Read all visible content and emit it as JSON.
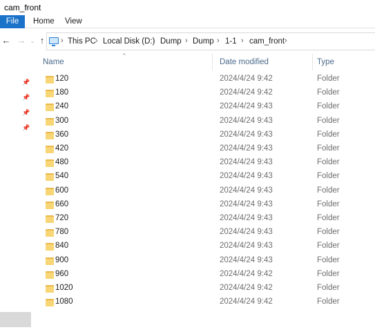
{
  "window": {
    "title": "cam_front"
  },
  "ribbon": {
    "tabs": [
      {
        "label": "File"
      },
      {
        "label": "Home"
      },
      {
        "label": "View"
      }
    ]
  },
  "nav": {
    "back_icon": "←",
    "forward_icon": "→",
    "recent_icon": "⌄",
    "up_icon": "↑",
    "breadcrumb": [
      "This PC",
      "Local Disk (D:)",
      "Dump",
      "Dump",
      "1-1",
      "cam_front"
    ],
    "separator": "›"
  },
  "columns": {
    "name": "Name",
    "date": "Date modified",
    "type": "Type",
    "sort_indicator": "^"
  },
  "files": [
    {
      "name": "120",
      "date": "2024/4/24 9:42",
      "type": "Folder"
    },
    {
      "name": "180",
      "date": "2024/4/24 9:42",
      "type": "Folder"
    },
    {
      "name": "240",
      "date": "2024/4/24 9:43",
      "type": "Folder"
    },
    {
      "name": "300",
      "date": "2024/4/24 9:43",
      "type": "Folder"
    },
    {
      "name": "360",
      "date": "2024/4/24 9:43",
      "type": "Folder"
    },
    {
      "name": "420",
      "date": "2024/4/24 9:43",
      "type": "Folder"
    },
    {
      "name": "480",
      "date": "2024/4/24 9:43",
      "type": "Folder"
    },
    {
      "name": "540",
      "date": "2024/4/24 9:43",
      "type": "Folder"
    },
    {
      "name": "600",
      "date": "2024/4/24 9:43",
      "type": "Folder"
    },
    {
      "name": "660",
      "date": "2024/4/24 9:43",
      "type": "Folder"
    },
    {
      "name": "720",
      "date": "2024/4/24 9:43",
      "type": "Folder"
    },
    {
      "name": "780",
      "date": "2024/4/24 9:43",
      "type": "Folder"
    },
    {
      "name": "840",
      "date": "2024/4/24 9:43",
      "type": "Folder"
    },
    {
      "name": "900",
      "date": "2024/4/24 9:43",
      "type": "Folder"
    },
    {
      "name": "960",
      "date": "2024/4/24 9:42",
      "type": "Folder"
    },
    {
      "name": "1020",
      "date": "2024/4/24 9:42",
      "type": "Folder"
    },
    {
      "name": "1080",
      "date": "2024/4/24 9:42",
      "type": "Folder"
    }
  ],
  "sidebar": {
    "pin_icon": "📌"
  },
  "colors": {
    "accent": "#1a73c9",
    "folder": "#f8d675",
    "folder_back": "#e8b84a"
  }
}
